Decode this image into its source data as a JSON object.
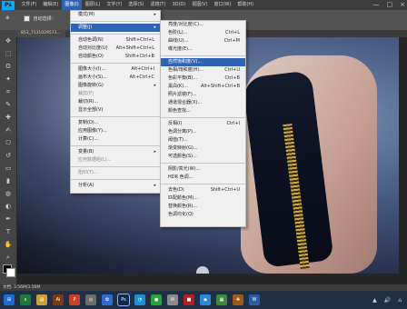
{
  "app": {
    "logo": "Ps"
  },
  "menubar": {
    "items": [
      "文件(F)",
      "编辑(E)",
      "图像(I)",
      "图层(L)",
      "文字(Y)",
      "选择(S)",
      "滤镜(T)",
      "3D(D)",
      "视图(V)",
      "窗口(W)",
      "帮助(H)"
    ],
    "active_index": 2,
    "window_controls": [
      "—",
      "□",
      "×"
    ]
  },
  "options_bar": {
    "auto_select_label": "自动选择：",
    "tool_hint": "⊕"
  },
  "document_tab": {
    "label": "853_7131029573..."
  },
  "status": {
    "text": "文档: 3.56M/3.56M"
  },
  "image_menu": {
    "items": [
      {
        "label": "模式(M)",
        "shortcut": "",
        "submenu": true
      },
      {
        "sep": true
      },
      {
        "label": "调整(J)",
        "shortcut": "",
        "submenu": true,
        "highlight": true
      },
      {
        "sep": true
      },
      {
        "label": "自动色调(N)",
        "shortcut": "Shift+Ctrl+L"
      },
      {
        "label": "自动对比度(U)",
        "shortcut": "Alt+Shift+Ctrl+L"
      },
      {
        "label": "自动颜色(O)",
        "shortcut": "Shift+Ctrl+B"
      },
      {
        "sep": true
      },
      {
        "label": "图像大小(I)...",
        "shortcut": "Alt+Ctrl+I"
      },
      {
        "label": "画布大小(S)...",
        "shortcut": "Alt+Ctrl+C"
      },
      {
        "label": "图像旋转(G)",
        "shortcut": "",
        "submenu": true
      },
      {
        "label": "裁剪(P)",
        "shortcut": "",
        "disabled": true
      },
      {
        "label": "裁切(R)...",
        "shortcut": ""
      },
      {
        "label": "显示全部(V)",
        "shortcut": ""
      },
      {
        "sep": true
      },
      {
        "label": "复制(D)...",
        "shortcut": ""
      },
      {
        "label": "应用图像(Y)...",
        "shortcut": ""
      },
      {
        "label": "计算(C)...",
        "shortcut": ""
      },
      {
        "sep": true
      },
      {
        "label": "变量(B)",
        "shortcut": "",
        "submenu": true
      },
      {
        "label": "应用数据组(L)...",
        "shortcut": "",
        "disabled": true
      },
      {
        "sep": true
      },
      {
        "label": "陷印(T)...",
        "shortcut": "",
        "disabled": true
      },
      {
        "sep": true
      },
      {
        "label": "分析(A)",
        "shortcut": "",
        "submenu": true
      }
    ]
  },
  "adjust_menu": {
    "items": [
      {
        "label": "亮度/对比度(C)...",
        "shortcut": ""
      },
      {
        "label": "色阶(L)...",
        "shortcut": "Ctrl+L"
      },
      {
        "label": "曲线(U)...",
        "shortcut": "Ctrl+M"
      },
      {
        "label": "曝光度(E)...",
        "shortcut": ""
      },
      {
        "sep": true
      },
      {
        "label": "自然饱和度(V)...",
        "shortcut": "",
        "highlight": true
      },
      {
        "label": "色相/饱和度(H)...",
        "shortcut": "Ctrl+U"
      },
      {
        "label": "色彩平衡(B)...",
        "shortcut": "Ctrl+B"
      },
      {
        "label": "黑白(K)...",
        "shortcut": "Alt+Shift+Ctrl+B"
      },
      {
        "label": "照片滤镜(F)...",
        "shortcut": ""
      },
      {
        "label": "通道混合器(X)...",
        "shortcut": ""
      },
      {
        "label": "颜色查找...",
        "shortcut": ""
      },
      {
        "sep": true
      },
      {
        "label": "反相(I)",
        "shortcut": "Ctrl+I"
      },
      {
        "label": "色调分离(P)...",
        "shortcut": ""
      },
      {
        "label": "阈值(T)...",
        "shortcut": ""
      },
      {
        "label": "渐变映射(G)...",
        "shortcut": ""
      },
      {
        "label": "可选颜色(S)...",
        "shortcut": ""
      },
      {
        "sep": true
      },
      {
        "label": "阴影/高光(W)...",
        "shortcut": ""
      },
      {
        "label": "HDR 色调...",
        "shortcut": ""
      },
      {
        "sep": true
      },
      {
        "label": "去色(D)",
        "shortcut": "Shift+Ctrl+U"
      },
      {
        "label": "匹配颜色(M)...",
        "shortcut": ""
      },
      {
        "label": "替换颜色(R)...",
        "shortcut": ""
      },
      {
        "label": "色调均化(Q)",
        "shortcut": ""
      }
    ]
  },
  "taskbar": {
    "icons": [
      {
        "name": "start-icon",
        "label": "⊞",
        "color": "#1f6bd7"
      },
      {
        "name": "excel-icon",
        "label": "x",
        "color": "#1d7a3b"
      },
      {
        "name": "explorer-icon",
        "label": "▤",
        "color": "#c8a13a"
      },
      {
        "name": "illustrator-icon",
        "label": "Ai",
        "color": "#7a3b12"
      },
      {
        "name": "powerpoint-icon",
        "label": "P",
        "color": "#c54322"
      },
      {
        "name": "app-icon-1",
        "label": "◎",
        "color": "#6c6c6c"
      },
      {
        "name": "app-icon-2",
        "label": "✿",
        "color": "#2e6dd6"
      },
      {
        "name": "photoshop-icon",
        "label": "Ps",
        "color": "#0b2b4d",
        "active": true
      },
      {
        "name": "browser-icon",
        "label": "◔",
        "color": "#1d90d2"
      },
      {
        "name": "chrome-icon",
        "label": "●",
        "color": "#26a33a"
      },
      {
        "name": "app-icon-3",
        "label": "✉",
        "color": "#8b8b8b"
      },
      {
        "name": "app-icon-4",
        "label": "■",
        "color": "#b51f1f"
      },
      {
        "name": "app-icon-5",
        "label": "◆",
        "color": "#2e88d6"
      },
      {
        "name": "app-icon-6",
        "label": "▦",
        "color": "#3c8a3c"
      },
      {
        "name": "app-icon-7",
        "label": "✚",
        "color": "#9b5b1b"
      },
      {
        "name": "word-icon",
        "label": "W",
        "color": "#2b5ba8"
      }
    ],
    "tray": [
      "▲",
      "🔊",
      "⌂"
    ]
  }
}
